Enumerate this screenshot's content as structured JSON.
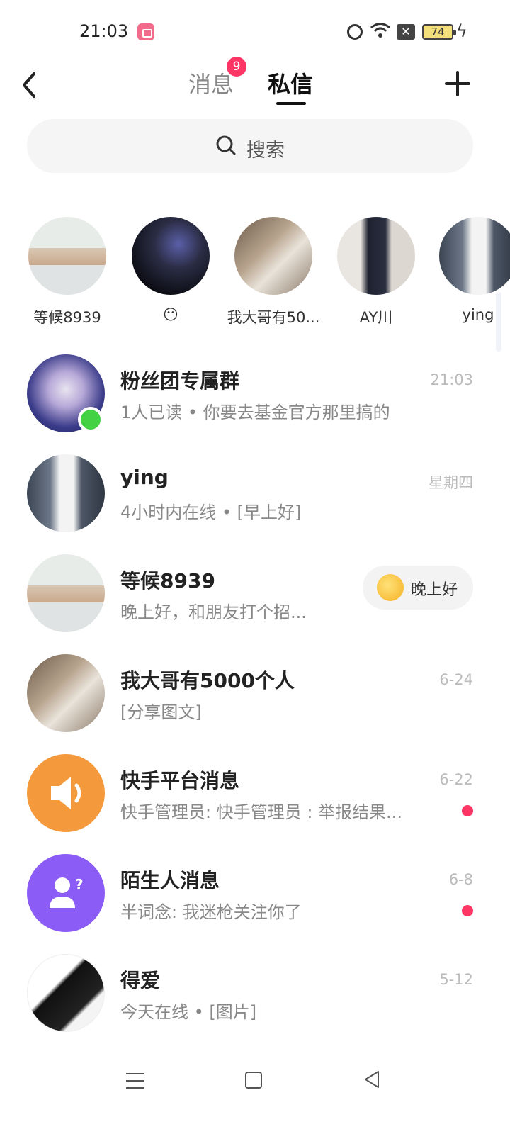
{
  "status_bar": {
    "time": "21:03",
    "battery": "74"
  },
  "header": {
    "tabs": [
      {
        "label": "消息",
        "badge": "9"
      },
      {
        "label": "私信"
      }
    ]
  },
  "search": {
    "placeholder": "搜索"
  },
  "stories": [
    {
      "name": "等候8939",
      "avatar": "man-white-shirt"
    },
    {
      "name": "😶",
      "avatar": "dark-anime-face"
    },
    {
      "name": "我大哥有50...",
      "avatar": "mirror-selfie"
    },
    {
      "name": "AY川",
      "avatar": "person-dark-coat"
    },
    {
      "name": "ying",
      "avatar": "woman-white-dress"
    }
  ],
  "conversations": [
    {
      "name": "粉丝团专属群",
      "preview": "1人已读 • 你要去基金官方那里搞的",
      "time": "21:03",
      "online": true,
      "avatar": "anime-cat-character"
    },
    {
      "name": "ying",
      "preview": "4小时内在线 • [早上好]",
      "time": "星期四",
      "avatar": "woman-white-dress"
    },
    {
      "name": "等候8939",
      "preview": "晚上好，和朋友打个招...",
      "greet_button": "晚上好",
      "avatar": "man-white-shirt"
    },
    {
      "name": "我大哥有5000个人",
      "preview": "[分享图文]",
      "time": "6-24",
      "avatar": "mirror-selfie"
    },
    {
      "name": "快手平台消息",
      "preview": "快手管理员: 快手管理员 : 举报结果...",
      "time": "6-22",
      "unread": true,
      "avatar": "speaker-icon"
    },
    {
      "name": "陌生人消息",
      "preview": "半词念: 我迷枪关注你了",
      "time": "6-8",
      "unread": true,
      "avatar": "stranger-icon"
    },
    {
      "name": "得爱",
      "preview": "今天在线 • [图片]",
      "time": "5-12",
      "avatar": "dark-anime-portrait"
    }
  ],
  "colors": {
    "accent": "#fe3666",
    "online": "#44d244",
    "platform": "#f59a3c",
    "stranger": "#8b5cf6"
  }
}
